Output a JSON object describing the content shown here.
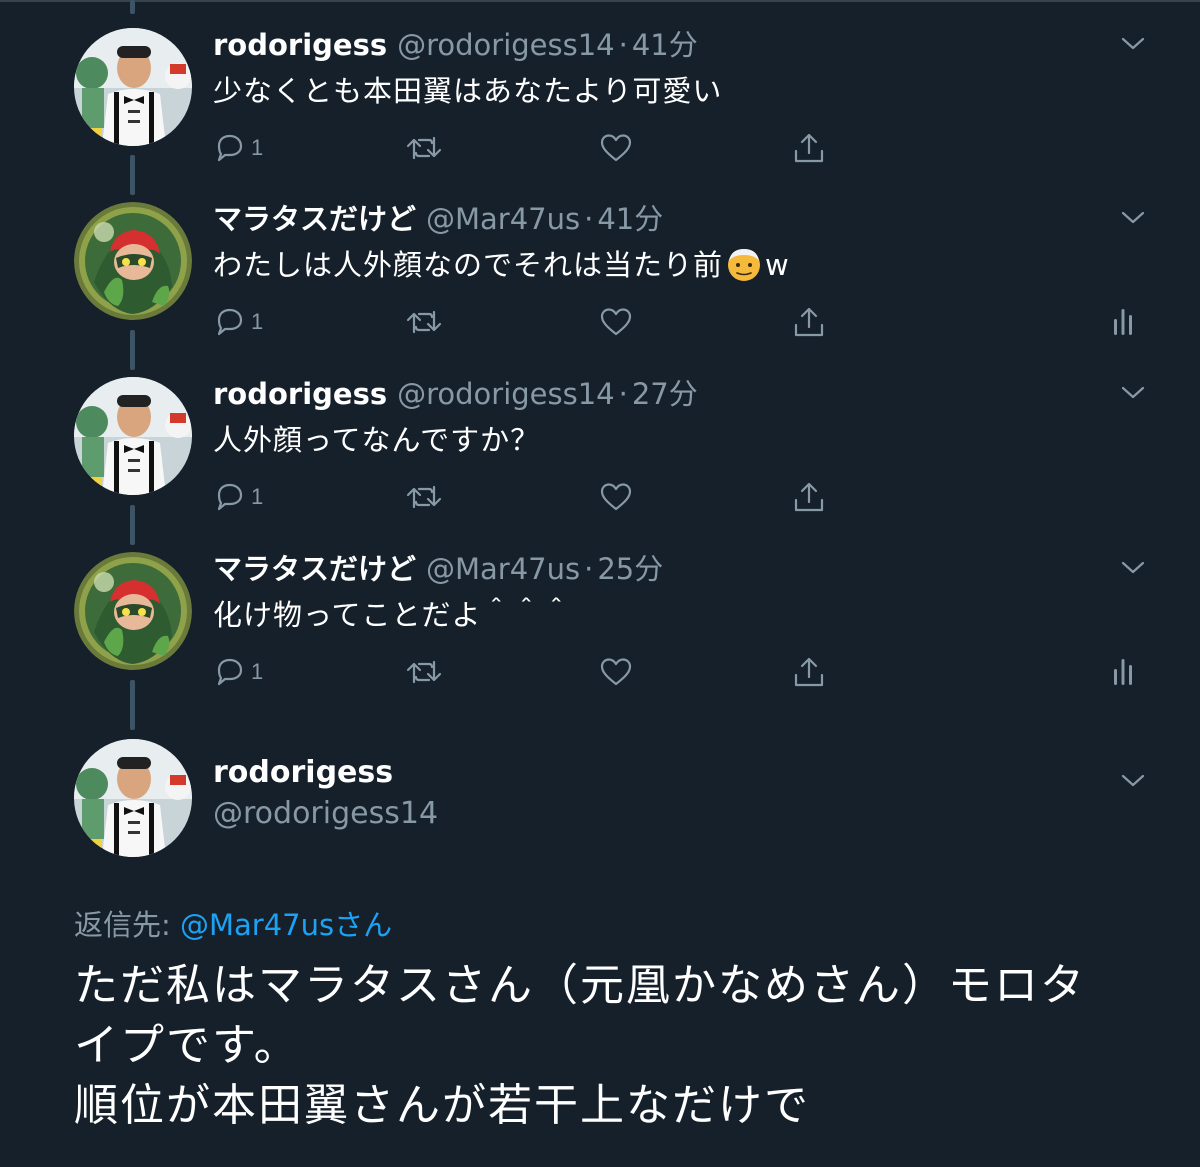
{
  "colors": {
    "background": "#15202b",
    "secondary_text": "#8899a6",
    "link": "#1da1f2",
    "thread_line": "#3d5466"
  },
  "icons": {
    "reply": "reply-icon",
    "retweet": "retweet-icon",
    "like": "heart-icon",
    "share": "share-icon",
    "analytics": "analytics-icon",
    "more": "chevron-down-icon"
  },
  "tweets": [
    {
      "name": "rodorigess",
      "handle": "@rodorigess14",
      "dot": "·",
      "time": "41分",
      "text": "少なくとも本田翼はあなたより可愛い",
      "reply_count": "1"
    },
    {
      "name": "マラタスだけど",
      "handle": "@Mar47us",
      "dot": "·",
      "time": "41分",
      "text_before_emoji": "わたしは人外顔なのでそれは当たり前",
      "text_after_emoji": "w",
      "reply_count": "1"
    },
    {
      "name": "rodorigess",
      "handle": "@rodorigess14",
      "dot": "·",
      "time": "27分",
      "text": "人外顔ってなんですか？",
      "reply_count": "1"
    },
    {
      "name": "マラタスだけど",
      "handle": "@Mar47us",
      "dot": "·",
      "time": "25分",
      "text": "化け物ってことだよ＾＾＾",
      "reply_count": "1"
    }
  ],
  "main_tweet": {
    "name": "rodorigess",
    "handle": "@rodorigess14",
    "reply_to_label": "返信先: ",
    "reply_to_mention": "@Mar47usさん",
    "text_lines": [
      "ただ私はマラタスさん（元凰かなめさん）モロタ",
      "イプです。",
      "順位が本田翼さんが若干上なだけで"
    ]
  }
}
